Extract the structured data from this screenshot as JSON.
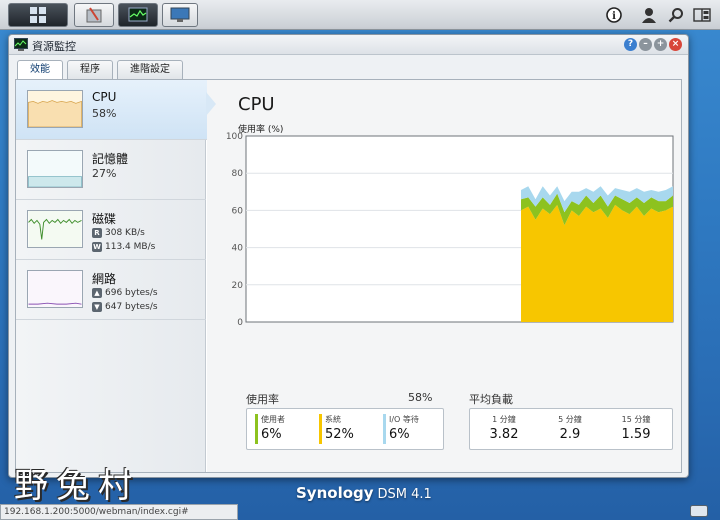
{
  "taskbar": {
    "buttons": [
      "home-icon",
      "package-center-icon",
      "resource-monitor-icon",
      "control-panel-icon"
    ],
    "right_icons": [
      "info-icon",
      "user-icon",
      "search-icon",
      "widgets-icon"
    ]
  },
  "window": {
    "title": "資源監控",
    "tabs": [
      {
        "label": "效能",
        "active": true
      },
      {
        "label": "程序",
        "active": false
      },
      {
        "label": "進階設定",
        "active": false
      }
    ],
    "controls": [
      "help-icon",
      "minimize-icon",
      "maximize-icon",
      "close-icon"
    ]
  },
  "sidebar": {
    "items": [
      {
        "name": "CPU",
        "value": "58%",
        "active": true
      },
      {
        "name": "記憶體",
        "value": "27%",
        "active": false
      },
      {
        "name": "磁碟",
        "read_badge": "R",
        "read": "308 KB/s",
        "write_badge": "W",
        "write": "113.4 MB/s",
        "active": false
      },
      {
        "name": "網路",
        "up": "696 bytes/s",
        "down": "647 bytes/s",
        "active": false
      }
    ]
  },
  "main": {
    "title": "CPU",
    "y_label": "使用率 (%)",
    "usage_label": "使用率",
    "usage_total": "58%",
    "load_label": "平均負載",
    "usage_stats": [
      {
        "label": "使用者",
        "value": "6%",
        "color": "#8dc21f"
      },
      {
        "label": "系統",
        "value": "52%",
        "color": "#f7c600"
      },
      {
        "label": "I/O 等待",
        "value": "6%",
        "color": "#a8d8ee"
      }
    ],
    "load_stats": [
      {
        "label": "1 分鐘",
        "value": "3.82"
      },
      {
        "label": "5 分鐘",
        "value": "2.9"
      },
      {
        "label": "15 分鐘",
        "value": "1.59"
      }
    ]
  },
  "chart_data": {
    "type": "area",
    "ylabel": "使用率 (%)",
    "ylim": [
      0,
      100
    ],
    "yticks": [
      0,
      20,
      40,
      60,
      80,
      100
    ],
    "grid": true,
    "x_count": 60,
    "start_index": 38,
    "series": [
      {
        "name": "系統",
        "color": "#f7c600",
        "values": [
          null,
          null,
          null,
          null,
          null,
          null,
          null,
          null,
          null,
          null,
          null,
          null,
          null,
          null,
          null,
          null,
          null,
          null,
          null,
          null,
          null,
          null,
          null,
          null,
          null,
          null,
          null,
          null,
          null,
          null,
          null,
          null,
          null,
          null,
          null,
          null,
          null,
          null,
          60,
          62,
          55,
          61,
          58,
          63,
          52,
          60,
          57,
          62,
          59,
          61,
          56,
          63,
          60,
          58,
          62,
          57,
          61,
          59,
          60,
          62
        ]
      },
      {
        "name": "使用者",
        "color": "#8dc21f",
        "values": [
          null,
          null,
          null,
          null,
          null,
          null,
          null,
          null,
          null,
          null,
          null,
          null,
          null,
          null,
          null,
          null,
          null,
          null,
          null,
          null,
          null,
          null,
          null,
          null,
          null,
          null,
          null,
          null,
          null,
          null,
          null,
          null,
          null,
          null,
          null,
          null,
          null,
          null,
          6,
          5,
          7,
          6,
          5,
          6,
          7,
          5,
          6,
          6,
          5,
          7,
          6,
          5,
          6,
          6,
          5,
          7,
          6,
          6,
          5,
          6
        ]
      },
      {
        "name": "I/O 等待",
        "color": "#a8d8ee",
        "values": [
          null,
          null,
          null,
          null,
          null,
          null,
          null,
          null,
          null,
          null,
          null,
          null,
          null,
          null,
          null,
          null,
          null,
          null,
          null,
          null,
          null,
          null,
          null,
          null,
          null,
          null,
          null,
          null,
          null,
          null,
          null,
          null,
          null,
          null,
          null,
          null,
          null,
          null,
          5,
          6,
          4,
          6,
          5,
          4,
          6,
          5,
          7,
          4,
          6,
          5,
          6,
          4,
          5,
          6,
          5,
          6,
          4,
          5,
          6,
          5
        ]
      }
    ]
  },
  "desktop": {
    "brand": "Synology",
    "brand_version": "DSM 4.1",
    "watermark": "野兔村",
    "status_url": "192.168.1.200:5000/webman/index.cgi#"
  }
}
